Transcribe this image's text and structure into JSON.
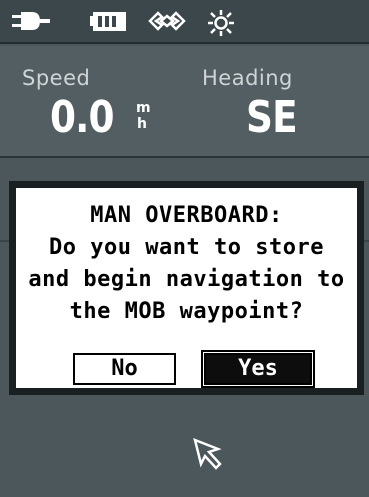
{
  "status_icons": [
    "power-plug-icon",
    "battery-icon",
    "satellite-signal-icon",
    "backlight-sun-icon"
  ],
  "fields": {
    "speed": {
      "label": "Speed",
      "value": "0.0",
      "unit_top": "m",
      "unit_bottom": "h"
    },
    "heading": {
      "label": "Heading",
      "value": "SE"
    }
  },
  "dialog": {
    "lines": [
      "MAN OVERBOARD:",
      "Do you want to store",
      "and begin navigation to",
      "the MOB waypoint?"
    ],
    "no_label": "No",
    "yes_label": "Yes",
    "selected": "Yes"
  },
  "colors": {
    "screen_bg": "#4a565a",
    "dialog_bg": "#ffffff",
    "selected_button_bg": "#0d0d0d"
  }
}
